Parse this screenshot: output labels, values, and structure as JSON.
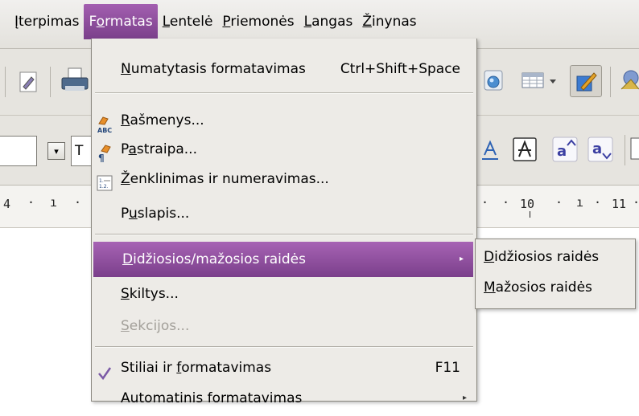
{
  "menubar": {
    "items": [
      {
        "pre": "",
        "u": "Į",
        "post": "terpimas"
      },
      {
        "pre": "F",
        "u": "o",
        "post": "rmatas"
      },
      {
        "pre": "",
        "u": "L",
        "post": "entelė"
      },
      {
        "pre": "",
        "u": "P",
        "post": "riemonės"
      },
      {
        "pre": "",
        "u": "L",
        "post": "angas"
      },
      {
        "pre": "",
        "u": "Ž",
        "post": "inynas"
      }
    ]
  },
  "toolbar2": {
    "font_name_partial": "T"
  },
  "ruler": {
    "left_number": "4",
    "mark_10": "10",
    "mark_11": "11"
  },
  "format_menu": {
    "default_formatting": {
      "pre": "",
      "u": "N",
      "post": "umatytasis formatavimas",
      "shortcut": "Ctrl+Shift+Space"
    },
    "characters": {
      "pre": "",
      "u": "R",
      "post": "ašmenys..."
    },
    "paragraph": {
      "pre": "P",
      "u": "a",
      "post": "straipa..."
    },
    "bullets": {
      "pre": "",
      "u": "Ž",
      "post": "enklinimas ir numeravimas..."
    },
    "page": {
      "pre": "P",
      "u": "u",
      "post": "slapis..."
    },
    "case": {
      "pre": "",
      "u": "D",
      "post": "idžiosios/mažosios raidės"
    },
    "columns": {
      "pre": "",
      "u": "S",
      "post": "kiltys..."
    },
    "sections": {
      "pre": "",
      "u": "S",
      "post": "ekcijos..."
    },
    "styles": {
      "pre": "Stiliai ir ",
      "u": "f",
      "post": "ormatavimas",
      "shortcut": "F11"
    },
    "autoformat_partial": "Automatinis formatavimas"
  },
  "case_submenu": {
    "upper": {
      "pre": "",
      "u": "D",
      "post": "idžiosios raidės"
    },
    "lower": {
      "pre": "",
      "u": "M",
      "post": "ažosios raidės"
    }
  },
  "colors": {
    "highlight_top": "#a763b4",
    "highlight_bottom": "#7b3f8b",
    "check": "#7b5aa6"
  }
}
